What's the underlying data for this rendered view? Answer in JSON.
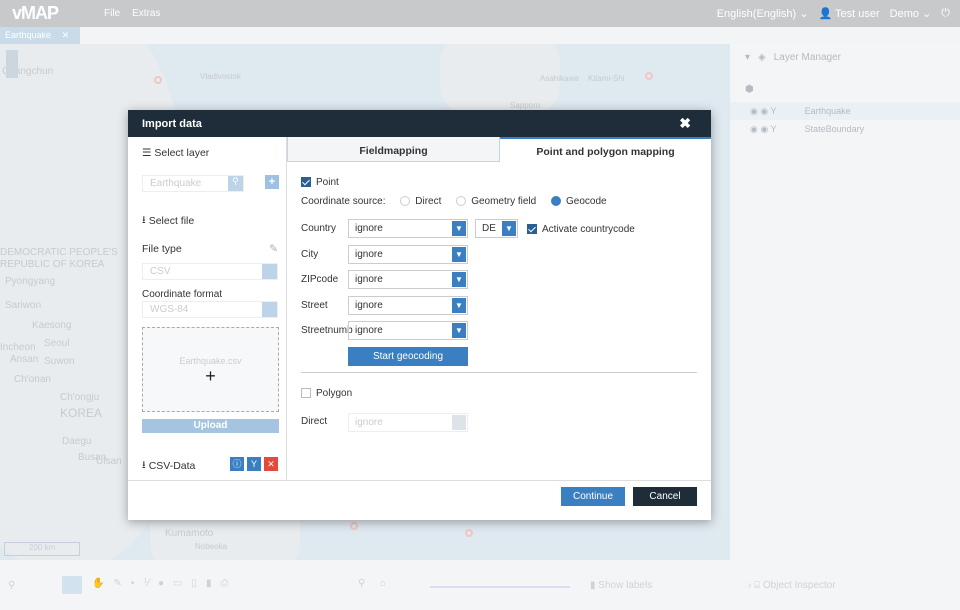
{
  "topbar": {
    "logo": "vMAP",
    "menu": [
      "File",
      "Extras"
    ],
    "language": "English(English)",
    "user": "Test user",
    "project": "Demo"
  },
  "map_tab": {
    "label": "Earthquake"
  },
  "map": {
    "labels": [
      "Changchun",
      "Pyongyang",
      "Sariwon",
      "Kaesong",
      "Seoul",
      "Suwon",
      "Incheon",
      "Ansan",
      "Ch'onan",
      "Ch'ongju",
      "KOREA",
      "Daegu",
      "Busan",
      "Ulsan",
      "Kumamoto",
      "Nobeoka",
      "DEMOCRATIC PEOPLE'S",
      "REPUBLIC OF KOREA",
      "Asahikawa",
      "Kitami-Shi",
      "Sapporo",
      "Vladivostok"
    ],
    "scale": "200 km"
  },
  "layer_manager": {
    "title": "Layer Manager",
    "layers": [
      "Earthquake",
      "StateBoundary"
    ],
    "selected": "Earthquake"
  },
  "object_inspector": {
    "title": "Object Inspector"
  },
  "bottom": {
    "show_labels": "Show labels"
  },
  "dialog": {
    "title": "Import data",
    "left": {
      "select_layer": "Select layer",
      "layer_value": "Earthquake",
      "select_file": "Select file",
      "file_type_label": "File type",
      "file_type": "CSV",
      "coord_format_label": "Coordinate format",
      "coord_format": "WGS-84",
      "file_name": "Earthquake.csv",
      "upload": "Upload",
      "csv_data": "CSV-Data"
    },
    "tabs": [
      {
        "label": "Fieldmapping",
        "active": false
      },
      {
        "label": "Point and polygon mapping",
        "active": true
      }
    ],
    "point": {
      "label": "Point",
      "checked": true,
      "coord_source_label": "Coordinate source:",
      "sources": [
        "Direct",
        "Geometry field",
        "Geocode"
      ],
      "selected_source": "Geocode",
      "fields": [
        {
          "label": "Country",
          "value": "ignore"
        },
        {
          "label": "City",
          "value": "ignore"
        },
        {
          "label": "ZIPcode",
          "value": "ignore"
        },
        {
          "label": "Street",
          "value": "ignore"
        },
        {
          "label": "Streetnumb",
          "value": "ignore"
        }
      ],
      "country_code": "DE",
      "activate_countrycode": "Activate countrycode",
      "activate_checked": true,
      "start_geocoding": "Start geocoding"
    },
    "polygon": {
      "label": "Polygon",
      "checked": false,
      "direct_label": "Direct",
      "direct_value": "ignore"
    },
    "continue": "Continue",
    "cancel": "Cancel"
  },
  "colors": {
    "accent": "#3a7fc1",
    "header": "#1f2d3a",
    "danger": "#e24b3b"
  }
}
